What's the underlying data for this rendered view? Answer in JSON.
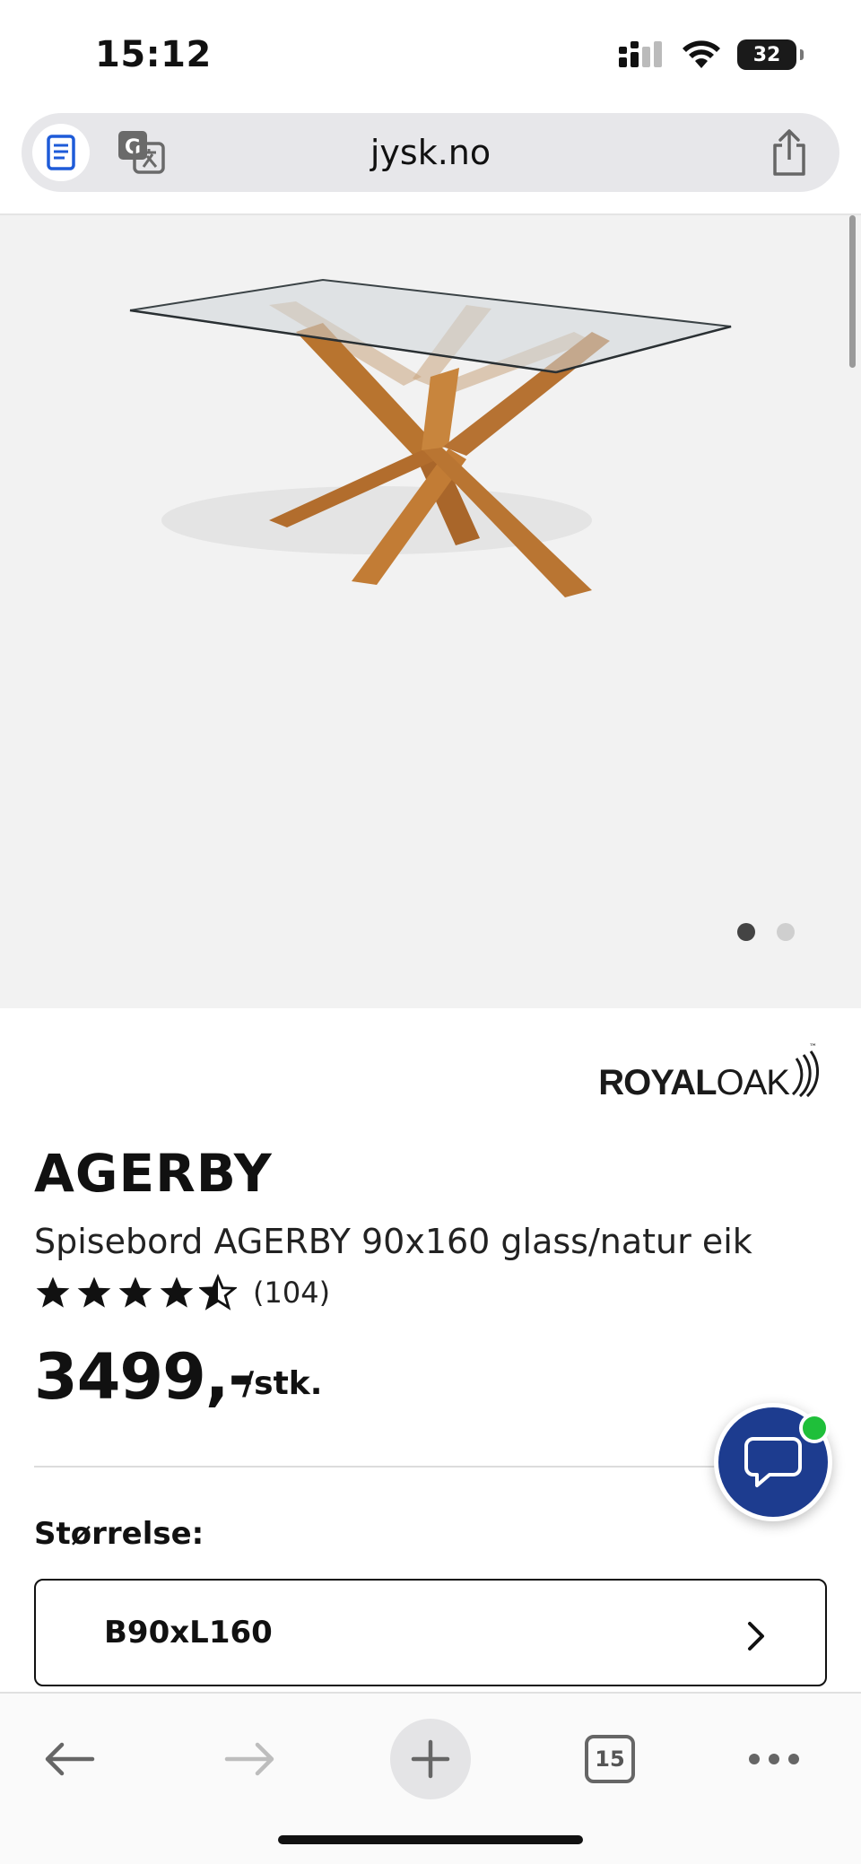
{
  "status_bar": {
    "time": "15:12",
    "battery_level": "32"
  },
  "browser": {
    "url": "jysk.no",
    "tab_count": "15"
  },
  "gallery": {
    "total_images": 2,
    "active_index": 0
  },
  "product": {
    "brand_part1": "ROYAL",
    "brand_part2": "OAK",
    "brand_tm": "™",
    "name": "AGERBY",
    "description": "Spisebord AGERBY 90x160 glass/natur eik",
    "rating": 4.5,
    "review_count": "(104)",
    "price": "3499,-",
    "price_unit": "/stk."
  },
  "size_selector": {
    "label": "Størrelse:",
    "value": "B90xL160"
  },
  "colors": {
    "chat_blue": "#1d3c8f",
    "online_green": "#1fbf3a",
    "hero_background": "#f2f2f2"
  }
}
